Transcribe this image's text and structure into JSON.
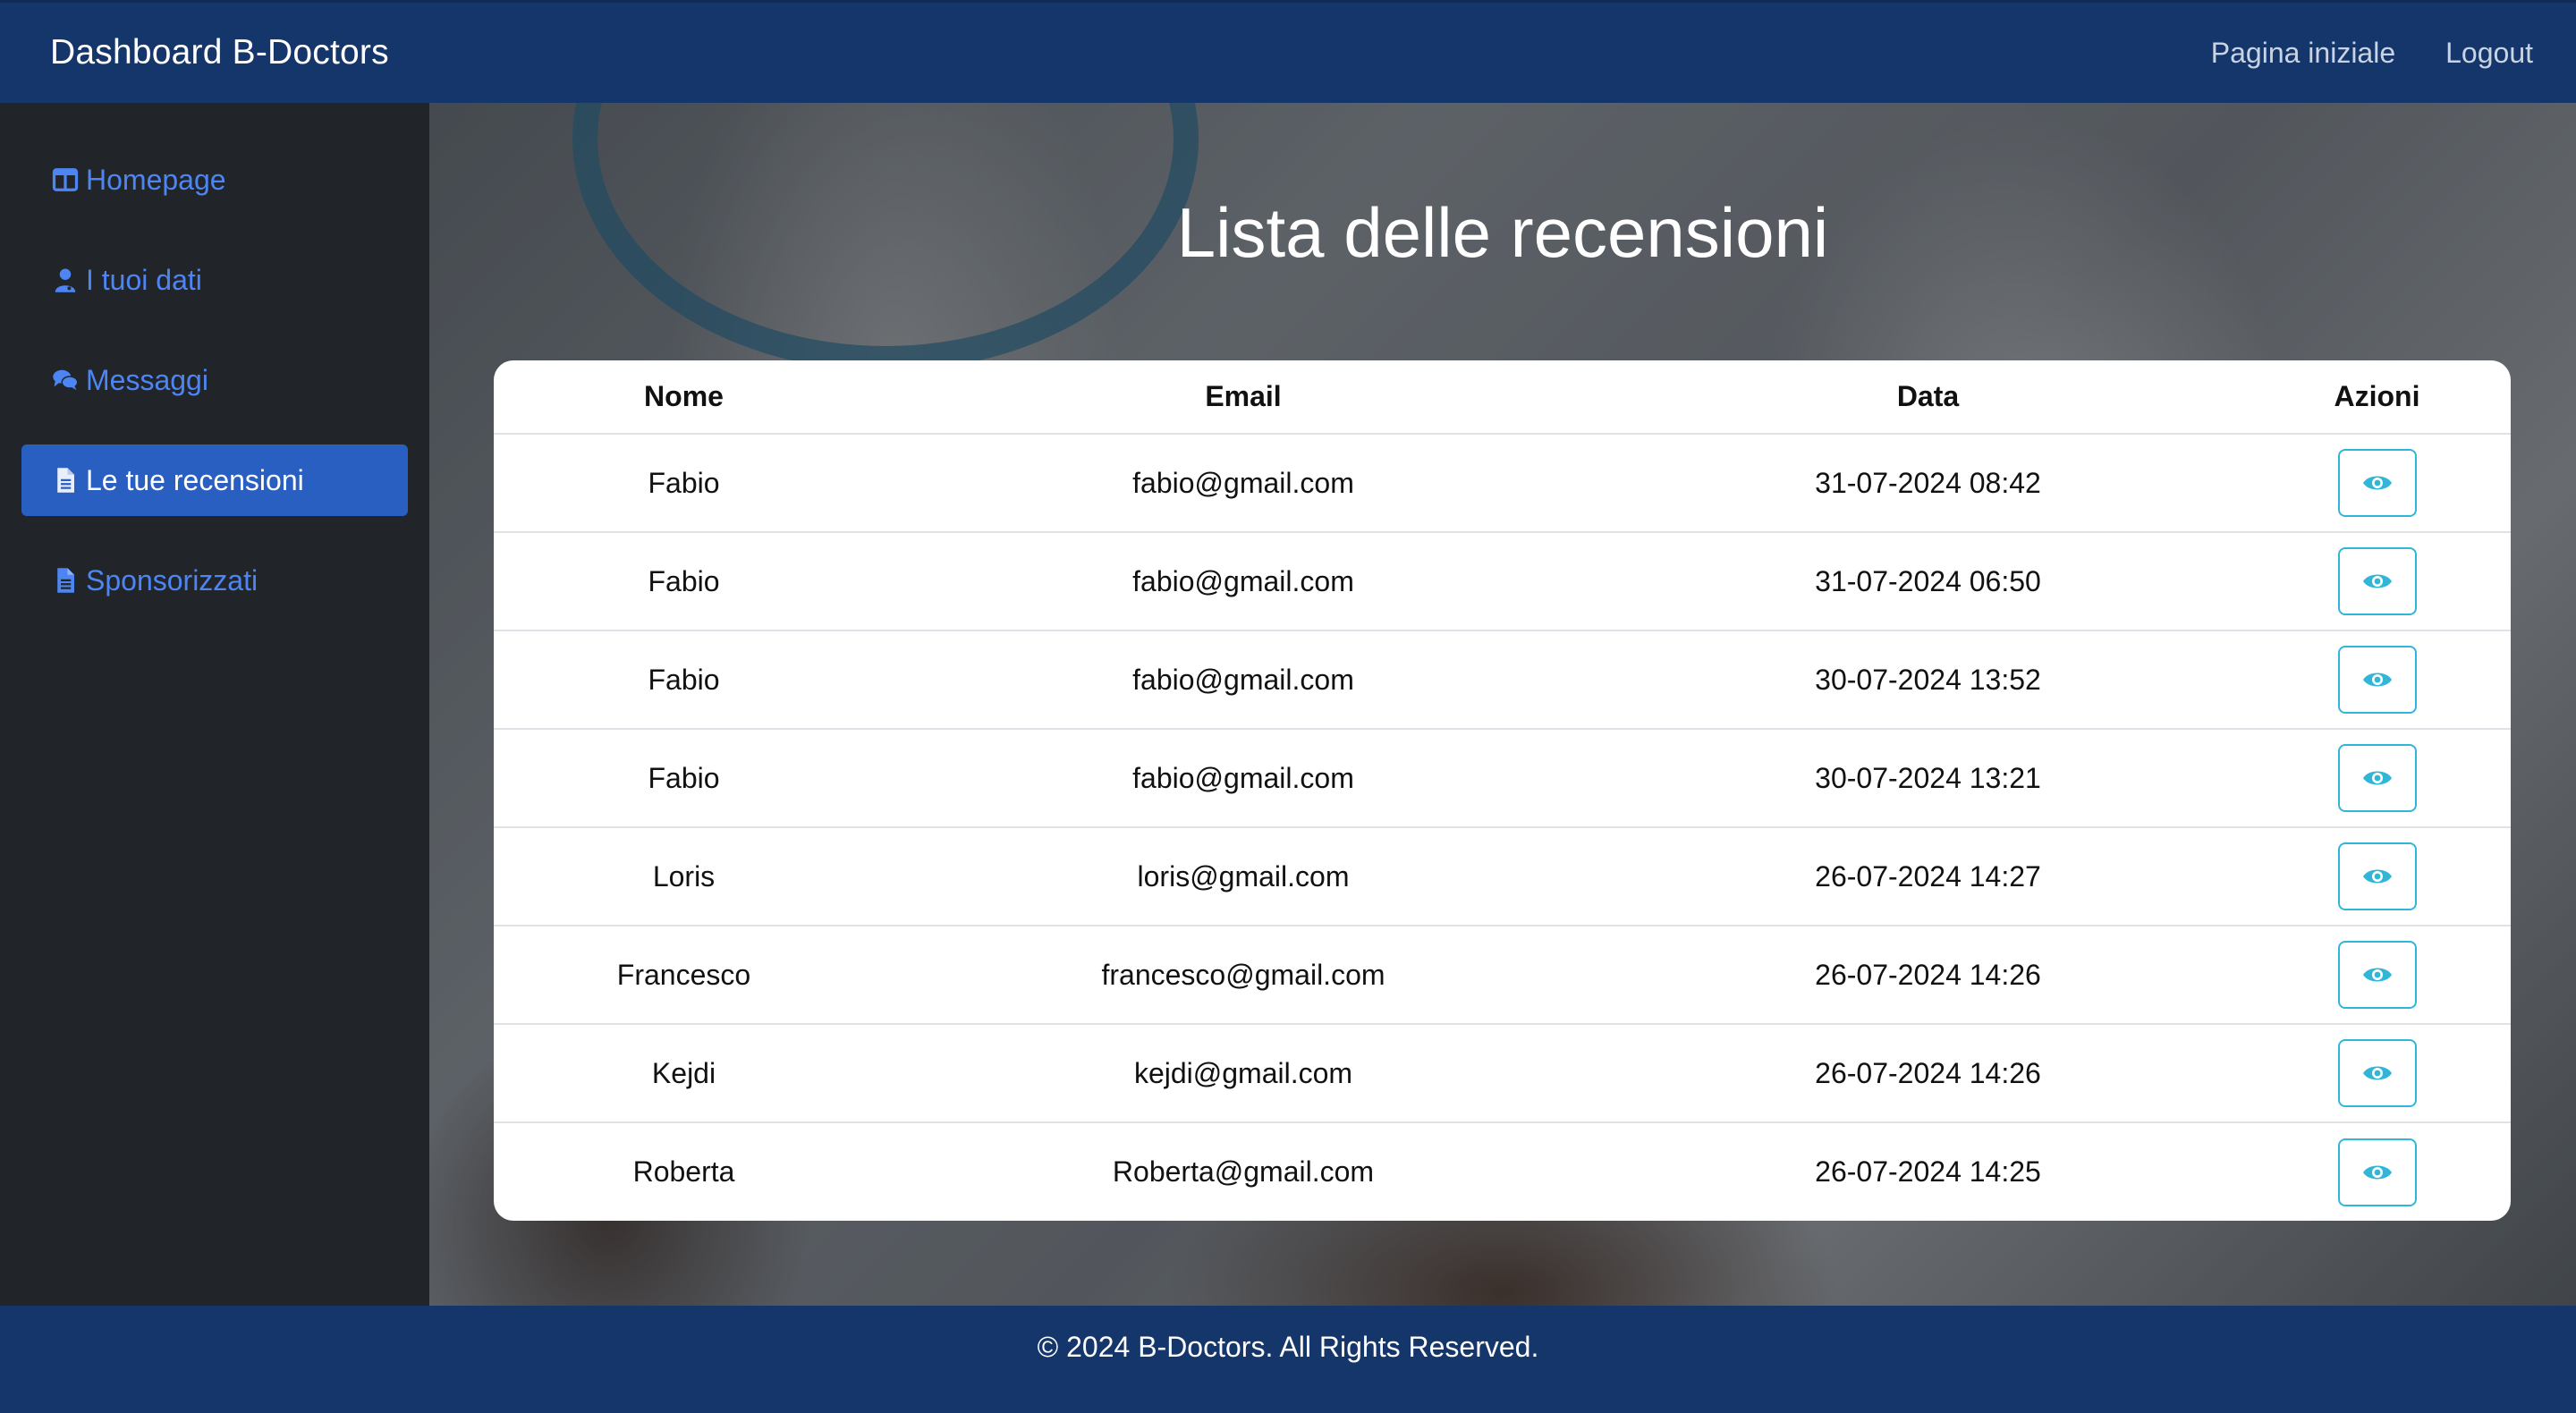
{
  "navbar": {
    "brand": "Dashboard B-Doctors",
    "links": [
      "Pagina iniziale",
      "Logout"
    ]
  },
  "sidebar": {
    "items": [
      {
        "label": "Homepage",
        "icon": "columns-icon",
        "active": false
      },
      {
        "label": "I tuoi dati",
        "icon": "user-doctor-icon",
        "active": false
      },
      {
        "label": "Messaggi",
        "icon": "comments-icon",
        "active": false
      },
      {
        "label": "Le tue recensioni",
        "icon": "file-icon",
        "active": true
      },
      {
        "label": "Sponsorizzati",
        "icon": "file-icon",
        "active": false
      }
    ]
  },
  "main": {
    "title": "Lista delle recensioni",
    "table": {
      "columns": [
        "Nome",
        "Email",
        "Data",
        "Azioni"
      ],
      "rows": [
        {
          "nome": "Fabio",
          "email": "fabio@gmail.com",
          "data": "31-07-2024 08:42"
        },
        {
          "nome": "Fabio",
          "email": "fabio@gmail.com",
          "data": "31-07-2024 06:50"
        },
        {
          "nome": "Fabio",
          "email": "fabio@gmail.com",
          "data": "30-07-2024 13:52"
        },
        {
          "nome": "Fabio",
          "email": "fabio@gmail.com",
          "data": "30-07-2024 13:21"
        },
        {
          "nome": "Loris",
          "email": "loris@gmail.com",
          "data": "26-07-2024 14:27"
        },
        {
          "nome": "Francesco",
          "email": "francesco@gmail.com",
          "data": "26-07-2024 14:26"
        },
        {
          "nome": "Kejdi",
          "email": "kejdi@gmail.com",
          "data": "26-07-2024 14:26"
        },
        {
          "nome": "Roberta",
          "email": "Roberta@gmail.com",
          "data": "26-07-2024 14:25"
        }
      ],
      "action_icon": "eye-icon"
    }
  },
  "footer": {
    "text": "© 2024 B-Doctors. All Rights Reserved."
  },
  "colors": {
    "navbar": "#14366b",
    "sidebar": "#212529",
    "sidebar_link": "#4d86f2",
    "sidebar_active": "#2a5fc2",
    "action_button": "#31b6d8"
  }
}
